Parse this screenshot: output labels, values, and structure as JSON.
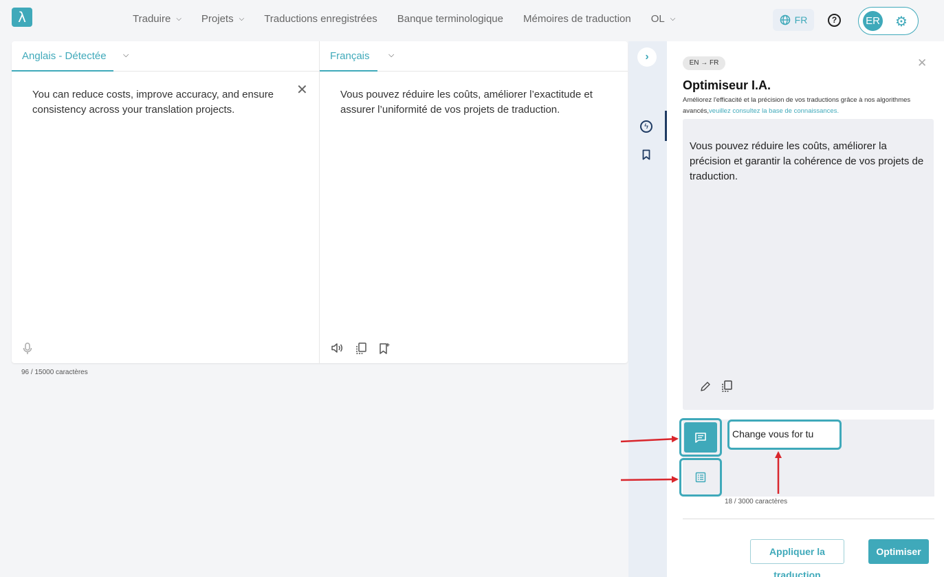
{
  "app": {
    "logo_glyph": "λ",
    "accent": "#3fa9ba",
    "rail_accent": "#1f3b63"
  },
  "nav": {
    "items": [
      {
        "label": "Traduire",
        "dropdown": true
      },
      {
        "label": "Projets",
        "dropdown": true
      },
      {
        "label": "Traductions enregistrées",
        "dropdown": false
      },
      {
        "label": "Banque terminologique",
        "dropdown": false
      },
      {
        "label": "Mémoires de traduction",
        "dropdown": false
      },
      {
        "label": "OL",
        "dropdown": true
      }
    ],
    "language": "FR",
    "user_initials": "ER"
  },
  "source": {
    "tab_label": "Anglais - Détectée",
    "text": "You can reduce costs, improve accuracy, and ensure consistency across your translation projects.",
    "char_count": "96 / 15000 caractères"
  },
  "target": {
    "tab_label": "Français",
    "text": "Vous pouvez réduire les coûts, améliorer l’exactitude et assurer l’uniformité de vos projets de traduction."
  },
  "optimizer": {
    "lang_pair": "EN → FR",
    "title": "Optimiseur I.A.",
    "description": "Améliorez l'efficacité et la précision de vos traductions grâce à nos algorithmes avancés,",
    "link_text": "veuillez consultez la base de connaissances.",
    "result_text": "Vous pouvez réduire les coûts, améliorer la précision et garantir la cohérence de vos projets de traduction.",
    "prompt_value": "Change vous for tu",
    "prompt_count": "18 / 3000 caractères",
    "apply_label": "Appliquer la traduction",
    "optimize_label": "Optimiser"
  }
}
